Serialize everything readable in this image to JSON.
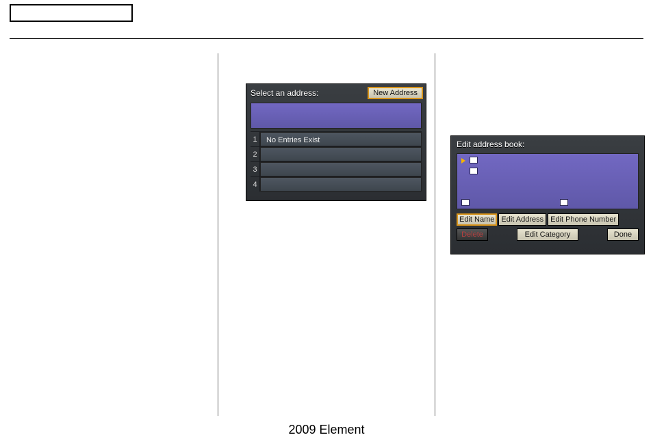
{
  "footer": "2009  Element",
  "screen1": {
    "title": "Select an address:",
    "new_button": "New Address",
    "rows": [
      {
        "n": "1",
        "text": "No Entries Exist"
      },
      {
        "n": "2",
        "text": ""
      },
      {
        "n": "3",
        "text": ""
      },
      {
        "n": "4",
        "text": ""
      }
    ]
  },
  "screen2": {
    "title": "Edit address book:",
    "buttons": {
      "edit_name": "Edit Name",
      "edit_address": "Edit Address",
      "edit_phone": "Edit Phone Number",
      "delete": "Delete",
      "edit_category": "Edit Category",
      "done": "Done"
    },
    "icons": {
      "slot1": "marker-icon",
      "slot2": "home-icon",
      "slot3": "phone-icon",
      "slot4": "category-icon"
    }
  }
}
